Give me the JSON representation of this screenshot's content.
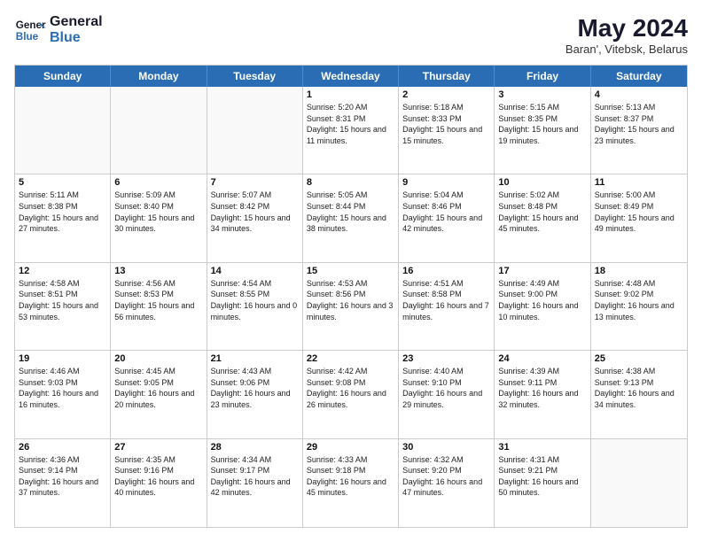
{
  "logo": {
    "line1": "General",
    "line2": "Blue"
  },
  "title": "May 2024",
  "subtitle": "Baran', Vitebsk, Belarus",
  "days_of_week": [
    "Sunday",
    "Monday",
    "Tuesday",
    "Wednesday",
    "Thursday",
    "Friday",
    "Saturday"
  ],
  "weeks": [
    [
      {
        "day": "",
        "empty": true
      },
      {
        "day": "",
        "empty": true
      },
      {
        "day": "",
        "empty": true
      },
      {
        "day": "1",
        "sunrise": "5:20 AM",
        "sunset": "8:31 PM",
        "daylight": "15 hours and 11 minutes."
      },
      {
        "day": "2",
        "sunrise": "5:18 AM",
        "sunset": "8:33 PM",
        "daylight": "15 hours and 15 minutes."
      },
      {
        "day": "3",
        "sunrise": "5:15 AM",
        "sunset": "8:35 PM",
        "daylight": "15 hours and 19 minutes."
      },
      {
        "day": "4",
        "sunrise": "5:13 AM",
        "sunset": "8:37 PM",
        "daylight": "15 hours and 23 minutes."
      }
    ],
    [
      {
        "day": "5",
        "sunrise": "5:11 AM",
        "sunset": "8:38 PM",
        "daylight": "15 hours and 27 minutes."
      },
      {
        "day": "6",
        "sunrise": "5:09 AM",
        "sunset": "8:40 PM",
        "daylight": "15 hours and 30 minutes."
      },
      {
        "day": "7",
        "sunrise": "5:07 AM",
        "sunset": "8:42 PM",
        "daylight": "15 hours and 34 minutes."
      },
      {
        "day": "8",
        "sunrise": "5:05 AM",
        "sunset": "8:44 PM",
        "daylight": "15 hours and 38 minutes."
      },
      {
        "day": "9",
        "sunrise": "5:04 AM",
        "sunset": "8:46 PM",
        "daylight": "15 hours and 42 minutes."
      },
      {
        "day": "10",
        "sunrise": "5:02 AM",
        "sunset": "8:48 PM",
        "daylight": "15 hours and 45 minutes."
      },
      {
        "day": "11",
        "sunrise": "5:00 AM",
        "sunset": "8:49 PM",
        "daylight": "15 hours and 49 minutes."
      }
    ],
    [
      {
        "day": "12",
        "sunrise": "4:58 AM",
        "sunset": "8:51 PM",
        "daylight": "15 hours and 53 minutes."
      },
      {
        "day": "13",
        "sunrise": "4:56 AM",
        "sunset": "8:53 PM",
        "daylight": "15 hours and 56 minutes."
      },
      {
        "day": "14",
        "sunrise": "4:54 AM",
        "sunset": "8:55 PM",
        "daylight": "16 hours and 0 minutes."
      },
      {
        "day": "15",
        "sunrise": "4:53 AM",
        "sunset": "8:56 PM",
        "daylight": "16 hours and 3 minutes."
      },
      {
        "day": "16",
        "sunrise": "4:51 AM",
        "sunset": "8:58 PM",
        "daylight": "16 hours and 7 minutes."
      },
      {
        "day": "17",
        "sunrise": "4:49 AM",
        "sunset": "9:00 PM",
        "daylight": "16 hours and 10 minutes."
      },
      {
        "day": "18",
        "sunrise": "4:48 AM",
        "sunset": "9:02 PM",
        "daylight": "16 hours and 13 minutes."
      }
    ],
    [
      {
        "day": "19",
        "sunrise": "4:46 AM",
        "sunset": "9:03 PM",
        "daylight": "16 hours and 16 minutes."
      },
      {
        "day": "20",
        "sunrise": "4:45 AM",
        "sunset": "9:05 PM",
        "daylight": "16 hours and 20 minutes."
      },
      {
        "day": "21",
        "sunrise": "4:43 AM",
        "sunset": "9:06 PM",
        "daylight": "16 hours and 23 minutes."
      },
      {
        "day": "22",
        "sunrise": "4:42 AM",
        "sunset": "9:08 PM",
        "daylight": "16 hours and 26 minutes."
      },
      {
        "day": "23",
        "sunrise": "4:40 AM",
        "sunset": "9:10 PM",
        "daylight": "16 hours and 29 minutes."
      },
      {
        "day": "24",
        "sunrise": "4:39 AM",
        "sunset": "9:11 PM",
        "daylight": "16 hours and 32 minutes."
      },
      {
        "day": "25",
        "sunrise": "4:38 AM",
        "sunset": "9:13 PM",
        "daylight": "16 hours and 34 minutes."
      }
    ],
    [
      {
        "day": "26",
        "sunrise": "4:36 AM",
        "sunset": "9:14 PM",
        "daylight": "16 hours and 37 minutes."
      },
      {
        "day": "27",
        "sunrise": "4:35 AM",
        "sunset": "9:16 PM",
        "daylight": "16 hours and 40 minutes."
      },
      {
        "day": "28",
        "sunrise": "4:34 AM",
        "sunset": "9:17 PM",
        "daylight": "16 hours and 42 minutes."
      },
      {
        "day": "29",
        "sunrise": "4:33 AM",
        "sunset": "9:18 PM",
        "daylight": "16 hours and 45 minutes."
      },
      {
        "day": "30",
        "sunrise": "4:32 AM",
        "sunset": "9:20 PM",
        "daylight": "16 hours and 47 minutes."
      },
      {
        "day": "31",
        "sunrise": "4:31 AM",
        "sunset": "9:21 PM",
        "daylight": "16 hours and 50 minutes."
      },
      {
        "day": "",
        "empty": true
      }
    ]
  ]
}
